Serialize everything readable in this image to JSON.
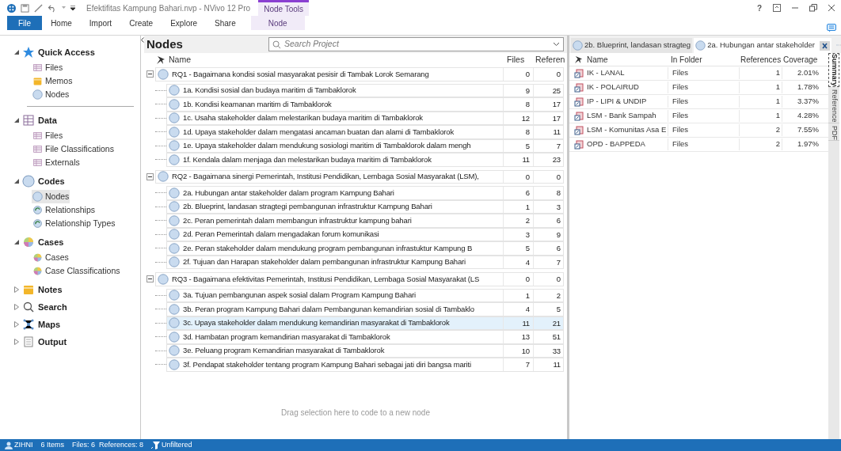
{
  "window": {
    "title": "Efektifitas Kampung Bahari.nvp - NVivo 12 Pro",
    "context_tab": "Node Tools"
  },
  "ribbon_tabs": [
    {
      "label": "File",
      "kind": "file",
      "selected": false
    },
    {
      "label": "Home",
      "kind": "tab",
      "selected": false
    },
    {
      "label": "Import",
      "kind": "tab",
      "selected": false
    },
    {
      "label": "Create",
      "kind": "tab",
      "selected": false
    },
    {
      "label": "Explore",
      "kind": "tab",
      "selected": false
    },
    {
      "label": "Share",
      "kind": "tab",
      "selected": false
    },
    {
      "label": "Node",
      "kind": "context",
      "selected": true
    }
  ],
  "window_controls": [
    "?"
  ],
  "nav": [
    {
      "label": "Quick Access",
      "kind": "star",
      "expanded": true,
      "items": [
        {
          "label": "Files",
          "kind": "files",
          "selected": false
        },
        {
          "label": "Memos",
          "kind": "memos",
          "selected": false
        },
        {
          "label": "Nodes",
          "kind": "nodes",
          "selected": false
        }
      ]
    },
    {
      "label": "Data",
      "kind": "data",
      "expanded": true,
      "items": [
        {
          "label": "Files",
          "kind": "files",
          "selected": false
        },
        {
          "label": "File Classifications",
          "kind": "files",
          "selected": false
        },
        {
          "label": "Externals",
          "kind": "files",
          "selected": false
        }
      ]
    },
    {
      "label": "Codes",
      "kind": "codes",
      "expanded": true,
      "items": [
        {
          "label": "Nodes",
          "kind": "nodes",
          "selected": true
        },
        {
          "label": "Relationships",
          "kind": "rel",
          "selected": false
        },
        {
          "label": "Relationship Types",
          "kind": "rel",
          "selected": false
        }
      ]
    },
    {
      "label": "Cases",
      "kind": "cases",
      "expanded": true,
      "items": [
        {
          "label": "Cases",
          "kind": "cases",
          "selected": false
        },
        {
          "label": "Case Classifications",
          "kind": "cases",
          "selected": false
        }
      ]
    },
    {
      "label": "Notes",
      "kind": "memos",
      "expanded": false
    },
    {
      "label": "Search",
      "kind": "search",
      "expanded": false
    },
    {
      "label": "Maps",
      "kind": "maps",
      "expanded": false
    },
    {
      "label": "Output",
      "kind": "output",
      "expanded": false
    }
  ],
  "nodes_panel": {
    "title": "Nodes",
    "search": {
      "placeholder": "Search Project"
    },
    "columns": [
      "Name",
      "Files",
      "Referen"
    ],
    "drop_hint": "Drag selection here to code to a new node",
    "groups": [
      {
        "name": "RQ1 - Bagaimana kondisi sosial masyarakat pesisir di Tambak Lorok Semarang",
        "files": "0",
        "refs": "0",
        "expanded": true,
        "children": [
          {
            "name": "1a. Kondisi sosial dan budaya maritim di Tambaklorok",
            "files": "9",
            "refs": "25",
            "selected": false
          },
          {
            "name": "1b. Kondisi keamanan maritim di Tambaklorok",
            "files": "8",
            "refs": "17",
            "selected": false
          },
          {
            "name": "1c. Usaha stakeholder dalam melestarikan budaya maritim di Tambaklorok",
            "files": "12",
            "refs": "17",
            "selected": false
          },
          {
            "name": "1d. Upaya stakeholder dalam mengatasi ancaman buatan dan alami di Tambaklorok",
            "files": "8",
            "refs": "11",
            "selected": false
          },
          {
            "name": "1e. Upaya stakeholder dalam mendukung sosiologi maritim di Tambaklorok dalam mengh",
            "files": "5",
            "refs": "7",
            "selected": false
          },
          {
            "name": "1f. Kendala dalam menjaga dan melestarikan budaya maritim di Tambaklorok",
            "files": "11",
            "refs": "23",
            "selected": false
          }
        ]
      },
      {
        "name": "RQ2 - Bagaimana sinergi Pemerintah, Institusi Pendidikan, Lembaga Sosial Masyarakat (LSM),",
        "files": "0",
        "refs": "0",
        "expanded": true,
        "children": [
          {
            "name": "2a. Hubungan antar stakeholder dalam program Kampung Bahari",
            "files": "6",
            "refs": "8",
            "selected": false
          },
          {
            "name": "2b. Blueprint, landasan stragtegi pembangunan infrastruktur Kampung Bahari",
            "files": "1",
            "refs": "3",
            "selected": false
          },
          {
            "name": "2c. Peran pemerintah dalam membangun infrastruktur kampung bahari",
            "files": "2",
            "refs": "6",
            "selected": false
          },
          {
            "name": "2d. Peran Pemerintah dalam mengadakan forum komunikasi",
            "files": "3",
            "refs": "9",
            "selected": false
          },
          {
            "name": "2e. Peran stakeholder dalam mendukung program pembangunan infrastuktur Kampung B",
            "files": "5",
            "refs": "6",
            "selected": false
          },
          {
            "name": "2f. Tujuan dan Harapan stakeholder dalam pembangunan infrastruktur Kampung Bahari",
            "files": "4",
            "refs": "7",
            "selected": false
          }
        ]
      },
      {
        "name": "RQ3 - Bagaimana efektivitas Pemerintah, Institusi Pendidikan, Lembaga Sosial Masyarakat (LS",
        "files": "0",
        "refs": "0",
        "expanded": true,
        "children": [
          {
            "name": "3a. Tujuan pembangunan aspek sosial dalam Program Kampung Bahari",
            "files": "1",
            "refs": "2",
            "selected": false
          },
          {
            "name": "3b. Peran program Kampung Bahari dalam Pembangunan kemandirian sosial di Tambaklo",
            "files": "4",
            "refs": "5",
            "selected": false
          },
          {
            "name": "3c. Upaya stakeholder dalam mendukung kemandirian masyarakat di Tambaklorok",
            "files": "11",
            "refs": "21",
            "selected": true
          },
          {
            "name": "3d. Hambatan program kemandirian masyarakat di Tambaklorok",
            "files": "13",
            "refs": "51",
            "selected": false
          },
          {
            "name": "3e. Peluang program Kemandirian masyarakat di Tambaklorok",
            "files": "10",
            "refs": "33",
            "selected": false
          },
          {
            "name": "3f. Pendapat stakeholder tentang program Kampung Bahari sebagai jati diri bangsa mariti",
            "files": "7",
            "refs": "11",
            "selected": false
          }
        ]
      }
    ]
  },
  "detail_panel": {
    "tabs": [
      {
        "label": "2b. Blueprint, landasan stragteg",
        "selected": false
      },
      {
        "label": "2a. Hubungan antar stakeholder",
        "selected": true
      }
    ],
    "columns": [
      "Name",
      "In Folder",
      "References",
      "Coverage"
    ],
    "rows": [
      {
        "name": "IK - LANAL",
        "folder": "Files",
        "references": "1",
        "coverage": "2.01%"
      },
      {
        "name": "IK - POLAIRUD",
        "folder": "Files",
        "references": "1",
        "coverage": "1.78%"
      },
      {
        "name": "IP - LIPI & UNDIP",
        "folder": "Files",
        "references": "1",
        "coverage": "3.37%"
      },
      {
        "name": "LSM - Bank Sampah",
        "folder": "Files",
        "references": "1",
        "coverage": "4.28%"
      },
      {
        "name": "LSM - Komunitas Asa E",
        "folder": "Files",
        "references": "2",
        "coverage": "7.55%"
      },
      {
        "name": "OPD - BAPPEDA",
        "folder": "Files",
        "references": "2",
        "coverage": "1.97%"
      }
    ],
    "side_tabs": [
      {
        "label": "Summary",
        "selected": true
      },
      {
        "label": "Reference",
        "selected": false
      },
      {
        "label": "PDF",
        "selected": false
      }
    ]
  },
  "status_bar": {
    "user": "ZIHNI",
    "items": "6 Items",
    "counts": "Files: 6  References: 8",
    "filter": "Unfiltered"
  }
}
